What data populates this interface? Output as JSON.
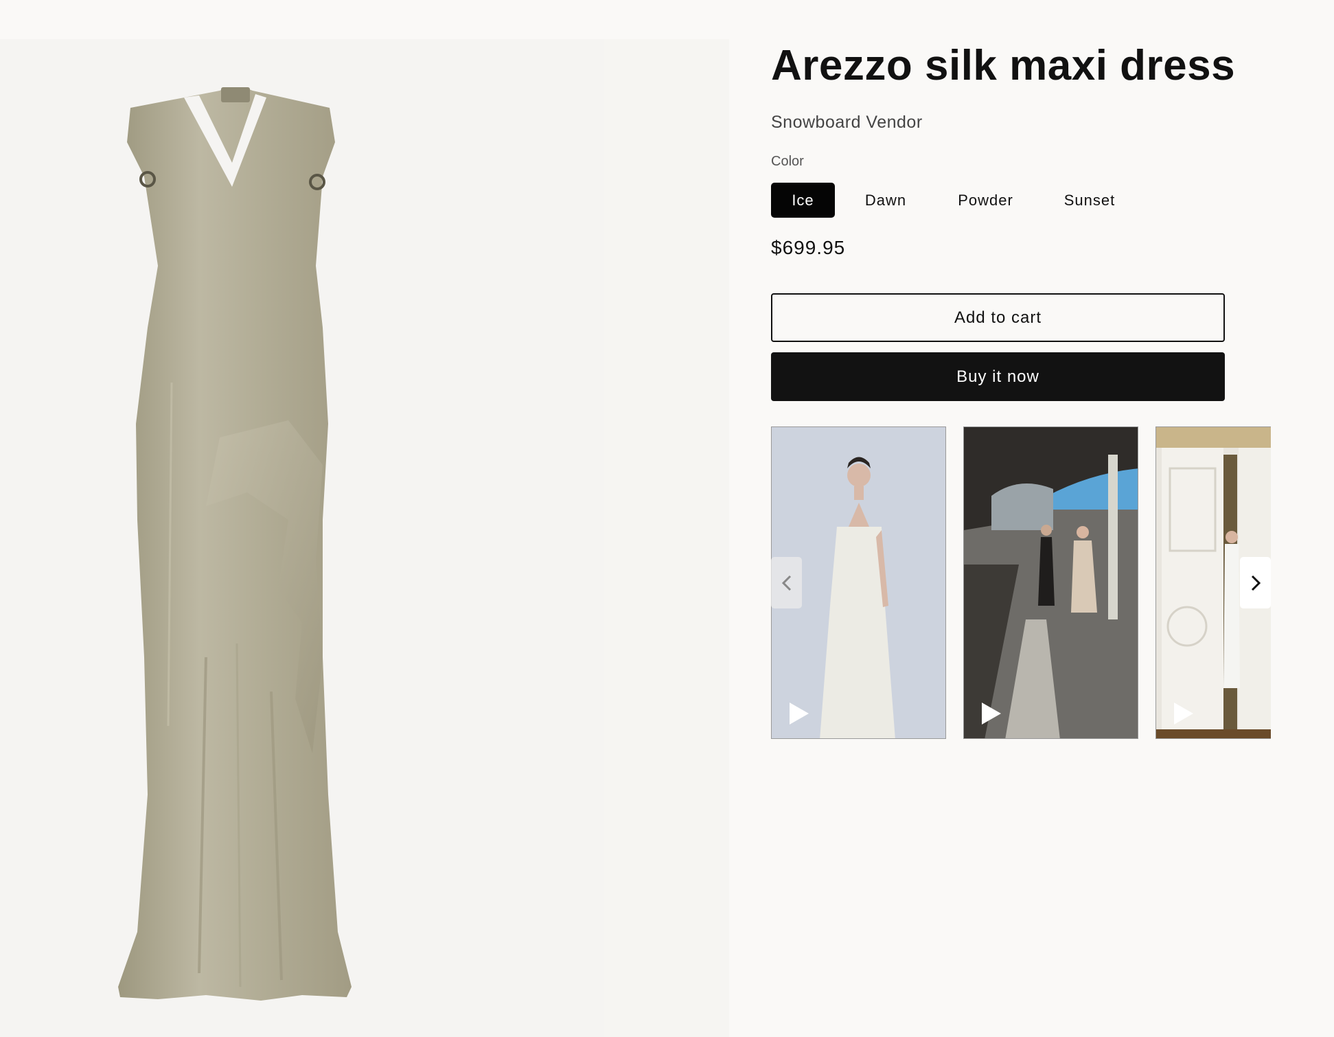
{
  "product": {
    "title": "Arezzo silk maxi dress",
    "vendor": "Snowboard Vendor",
    "color_label": "Color",
    "colors": [
      "Ice",
      "Dawn",
      "Powder",
      "Sunset"
    ],
    "selected_color": "Ice",
    "price": "$699.95"
  },
  "actions": {
    "add_to_cart": "Add to cart",
    "buy_now": "Buy it now"
  },
  "videos": [
    {
      "name": "video-model-white-dress",
      "icon": "play-icon"
    },
    {
      "name": "video-train-station",
      "icon": "play-icon"
    },
    {
      "name": "video-doorway",
      "icon": "play-icon"
    }
  ],
  "colors": {
    "page_bg": "#faf9f7",
    "dress": "#b7b29d",
    "primary_button": "#121212"
  }
}
